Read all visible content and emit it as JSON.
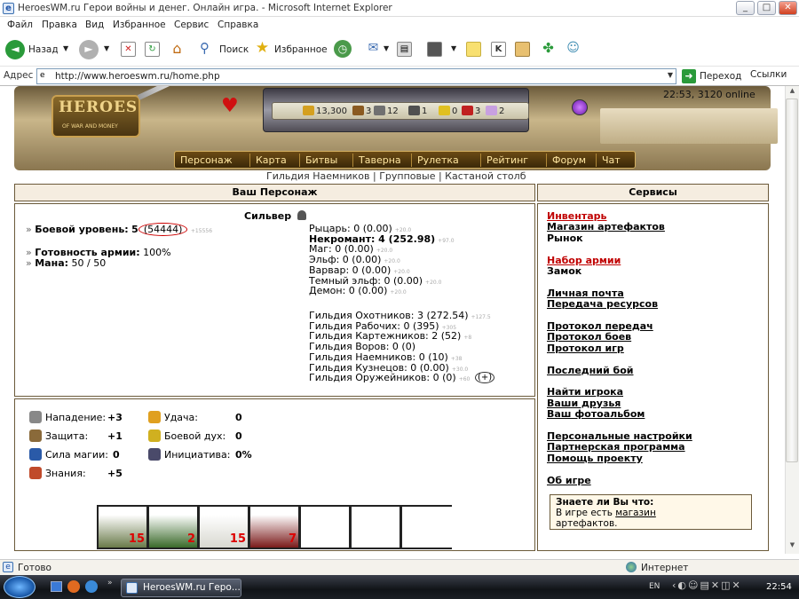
{
  "window": {
    "title": "HeroesWM.ru Герои войны и денег. Онлайн игра. - Microsoft Internet Explorer"
  },
  "menu": [
    "Файл",
    "Правка",
    "Вид",
    "Избранное",
    "Сервис",
    "Справка"
  ],
  "toolbar": {
    "back": "Назад",
    "search": "Поиск",
    "favorites": "Избранное"
  },
  "address": {
    "label": "Адрес",
    "url": "http://www.heroeswm.ru/home.php",
    "go": "Переход",
    "links": "Ссылки"
  },
  "header": {
    "logo_title": "HEROES",
    "logo_sub": "OF WAR AND MONEY",
    "online": "22:53, 3120 online",
    "resources": [
      {
        "value": "13,300",
        "color": "#d4a020"
      },
      {
        "value": "3",
        "color": "#8a5a20"
      },
      {
        "value": "12",
        "color": "#707070"
      },
      {
        "value": "1",
        "color": "#505050"
      },
      {
        "value": "0",
        "color": "#e0c020"
      },
      {
        "value": "3",
        "color": "#c02020"
      },
      {
        "value": "2",
        "color": "#c8a0e0"
      }
    ],
    "nav": [
      "Персонаж",
      "Карта",
      "Битвы",
      "Таверна",
      "Рулетка",
      "Рейтинг",
      "Форум",
      "Чат"
    ],
    "subnav": "Гильдия Наемников | Групповые | Кастаной столб"
  },
  "character": {
    "panel_title": "Ваш Персонаж",
    "name": "Сильвер",
    "combat_level_label": "Боевой уровень:",
    "combat_level": "5",
    "experience": "(54444)",
    "experience_next": "+15556",
    "army_ready_label": "Готовность армии:",
    "army_ready": "100%",
    "mana_label": "Мана:",
    "mana": "50 / 50",
    "factions": [
      {
        "text": "Рыцарь: 0 (0.00)",
        "delta": "+20.0"
      },
      {
        "text": "Некромант: 4 (252.98)",
        "delta": "+97.0",
        "bold": true
      },
      {
        "text": "Маг: 0 (0.00)",
        "delta": "+20.0"
      },
      {
        "text": "Эльф: 0 (0.00)",
        "delta": "+20.0"
      },
      {
        "text": "Варвар: 0 (0.00)",
        "delta": "+20.0"
      },
      {
        "text": "Темный эльф: 0 (0.00)",
        "delta": "+20.0"
      },
      {
        "text": "Демон: 0 (0.00)",
        "delta": "+20.0"
      }
    ],
    "guilds": [
      {
        "text": "Гильдия Охотников: 3 (272.54)",
        "delta": "+127.5"
      },
      {
        "text": "Гильдия Рабочих: 0 (395)",
        "delta": "+305"
      },
      {
        "text": "Гильдия Картежников: 2 (52)",
        "delta": "+8"
      },
      {
        "text": "Гильдия Воров: 0 (0)",
        "delta": ""
      },
      {
        "text": "Гильдия Наемников: 0 (10)",
        "delta": "+38"
      },
      {
        "text": "Гильдия Кузнецов: 0 (0.00)",
        "delta": "+30.0"
      },
      {
        "text": "Гильдия Оружейников: 0 (0)",
        "delta": "+60"
      }
    ],
    "guild_more": "(+)"
  },
  "attributes": [
    {
      "label": "Нападение:",
      "value": "+3",
      "color": "#888888"
    },
    {
      "label": "Защита:",
      "value": "+1",
      "color": "#8a6a3a"
    },
    {
      "label": "Сила магии:",
      "value": "0",
      "color": "#2a5aa8"
    },
    {
      "label": "Знания:",
      "value": "+5",
      "color": "#c04a2a"
    },
    {
      "label": "Удача:",
      "value": "0",
      "color": "#e0a020"
    },
    {
      "label": "Боевой дух:",
      "value": "0",
      "color": "#d0b020"
    },
    {
      "label": "Инициатива:",
      "value": "0%",
      "color": "#4a4a6a"
    }
  ],
  "army": [
    {
      "count": "15"
    },
    {
      "count": "2"
    },
    {
      "count": "15"
    },
    {
      "count": "7"
    },
    {
      "count": ""
    },
    {
      "count": ""
    },
    {
      "count": ""
    }
  ],
  "services": {
    "panel_title": "Сервисы",
    "links": [
      {
        "label": "Инвентарь",
        "red": true
      },
      {
        "label": "Магазин артефактов"
      },
      {
        "label": "Рынок",
        "plain": true
      },
      {
        "label": ""
      },
      {
        "label": "Набор армии",
        "red": true
      },
      {
        "label": "Замок",
        "plain": true
      },
      {
        "label": ""
      },
      {
        "label": "Личная почта"
      },
      {
        "label": "Передача ресурсов"
      },
      {
        "label": ""
      },
      {
        "label": "Протокол передач"
      },
      {
        "label": "Протокол боев"
      },
      {
        "label": "Протокол игр"
      },
      {
        "label": ""
      },
      {
        "label": "Последний бой"
      },
      {
        "label": ""
      },
      {
        "label": "Найти игрока"
      },
      {
        "label": "Ваши друзья"
      },
      {
        "label": "Ваш фотоальбом"
      },
      {
        "label": ""
      },
      {
        "label": "Персональные настройки"
      },
      {
        "label": "Партнерская программа"
      },
      {
        "label": "Помощь проекту"
      },
      {
        "label": ""
      },
      {
        "label": "Об игре"
      }
    ],
    "tip_title": "Знаете ли Вы что:",
    "tip_text": "В игре есть",
    "tip_link": "магазин",
    "tip_tail": "артефактов."
  },
  "status": {
    "text": "Готово",
    "zone": "Интернет"
  },
  "taskbar": {
    "task": "HeroesWM.ru Геро...",
    "lang": "EN",
    "clock": "22:54"
  }
}
